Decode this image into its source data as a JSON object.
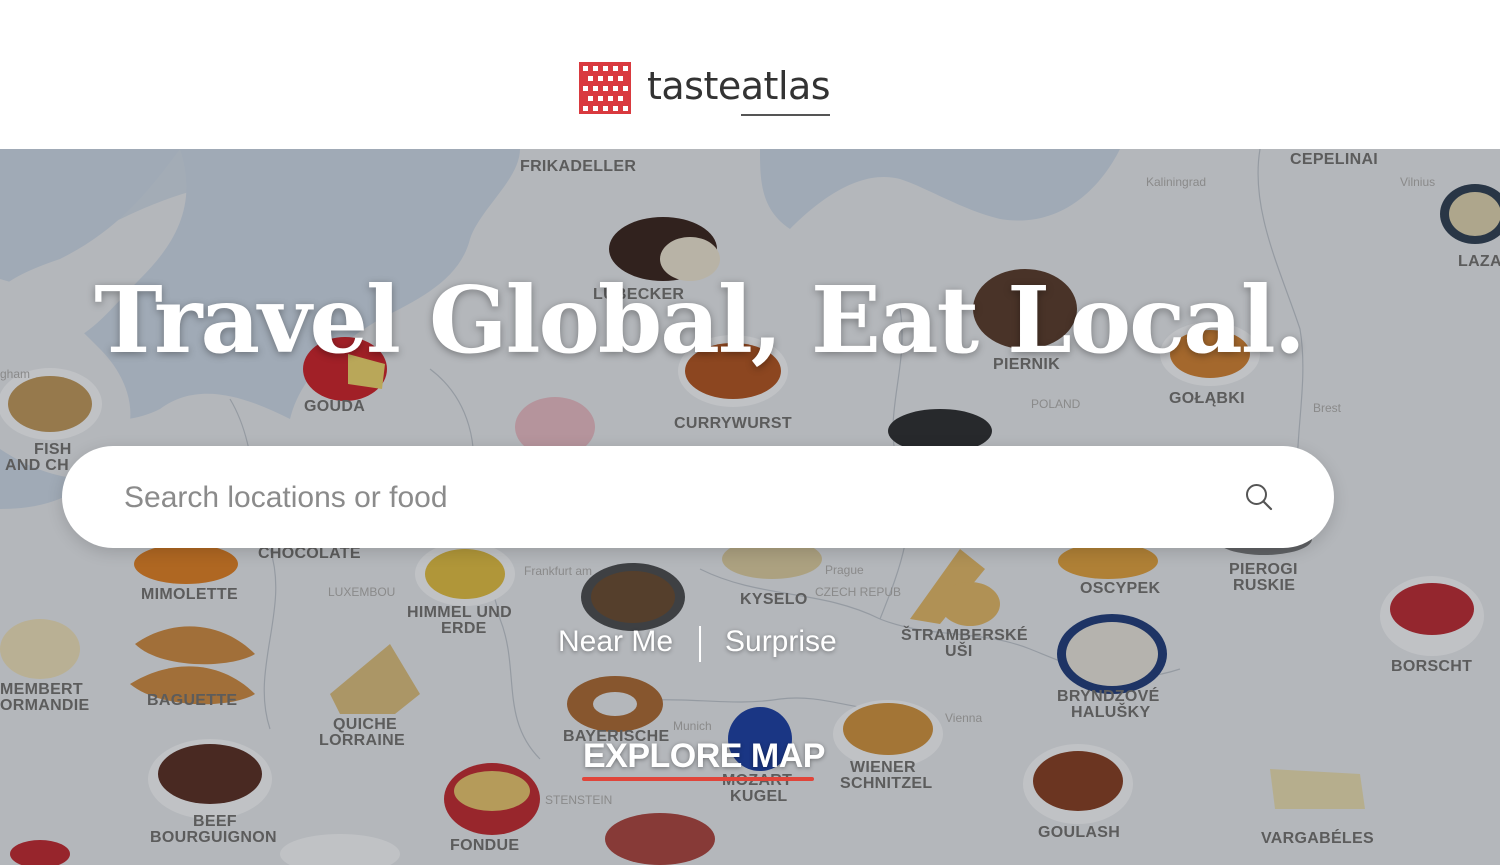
{
  "header": {
    "logo_text_a": "taste",
    "logo_text_b": "atlas",
    "brand_color": "#d93a3f"
  },
  "hero": {
    "headline": "Travel Global, Eat Local.",
    "search_placeholder": "Search locations or food",
    "near_me": "Near Me",
    "surprise": "Surprise",
    "explore": "EXPLORE MAP",
    "accent_color": "#e0453a"
  },
  "map": {
    "dishes": [
      "FRIKADELLER",
      "CEPELINAI",
      "LAZA",
      "LÜBECKER",
      "PIERNIK",
      "GOUDA",
      "GOŁĄBKI",
      "CURRYWURST",
      "FISH",
      "AND CH",
      "CHOCOLATE",
      "MIMOLETTE",
      "HIMMEL UND",
      "ERDE",
      "KYSELO",
      "OSCYPEK",
      "PIEROGI",
      "RUSKIE",
      "BORSCHT",
      "ŠTRAMBERSKÉ",
      "UŠI",
      "BRYNDZOVÉ",
      "HALUŠKY",
      "MEMBERT",
      "ORMANDIE",
      "BAGUETTE",
      "QUICHE",
      "LORRAINE",
      "BAYERISCHE",
      "MOZART",
      "KUGEL",
      "WIENER",
      "SCHNITZEL",
      "BEEF",
      "BOURGUIGNON",
      "FONDUE",
      "GOULASH",
      "VARGABÉLES"
    ],
    "cities": [
      "Kaliningrad",
      "Vilnius",
      "Brest",
      "POLAND",
      "LUXEMBOU",
      "Frankfurt am",
      "Prague",
      "CZECH REPUB",
      "Munich",
      "Vienna",
      "STENSTEIN",
      "gham"
    ]
  }
}
